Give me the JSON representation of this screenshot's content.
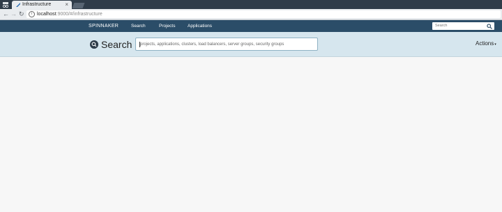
{
  "browser": {
    "tab_title": "Infrastructure",
    "tab_close": "×",
    "url_host": "localhost",
    "url_rest": ":9000/#/infrastructure",
    "back_glyph": "←",
    "forward_glyph": "→",
    "reload_glyph": "↻",
    "icons": [
      "incognito-icon",
      "favicon-icon",
      "info-icon"
    ]
  },
  "appnav": {
    "brand": "SPINNAKER",
    "links": [
      "Search",
      "Projects",
      "Applications"
    ],
    "search_placeholder": "Search"
  },
  "page": {
    "title": "Search",
    "search_placeholder": "projects, applications, clusters, load balancers, server groups, security groups",
    "actions_label": "Actions",
    "actions_caret": "▾"
  },
  "colors": {
    "nav_bg": "#2b4d68",
    "band_bg": "#d6e6ee",
    "page_bg": "#f7f7f7"
  }
}
